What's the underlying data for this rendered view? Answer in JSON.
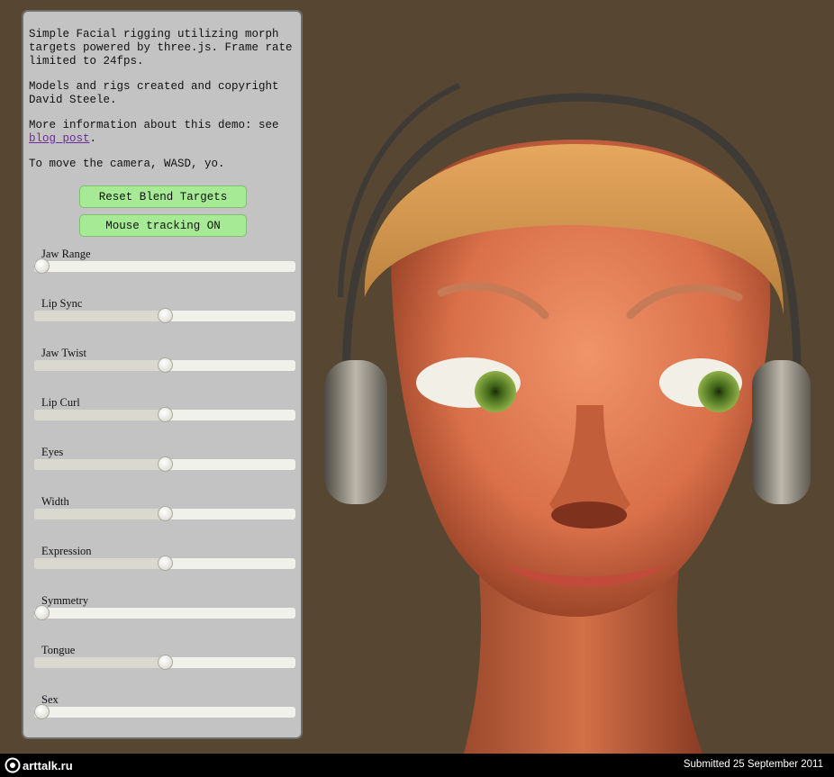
{
  "info": {
    "para1": "Simple Facial rigging utilizing morph targets powered by three.js. Frame rate limited to 24fps.",
    "para2": "Models and rigs created and copyright David Steele.",
    "para3_prefix": "More information about this demo: see ",
    "para3_link": "blog post",
    "para3_suffix": ".",
    "para4": "To move the camera, WASD, yo."
  },
  "buttons": {
    "reset": "Reset Blend Targets",
    "mouse": "Mouse tracking ON"
  },
  "sliders": [
    {
      "label": "Jaw Range",
      "value": 0
    },
    {
      "label": "Lip Sync",
      "value": 0.5
    },
    {
      "label": "Jaw Twist",
      "value": 0.5
    },
    {
      "label": "Lip Curl",
      "value": 0.5
    },
    {
      "label": "Eyes",
      "value": 0.5
    },
    {
      "label": "Width",
      "value": 0.5
    },
    {
      "label": "Expression",
      "value": 0.5
    },
    {
      "label": "Symmetry",
      "value": 0
    },
    {
      "label": "Tongue",
      "value": 0.5
    },
    {
      "label": "Sex",
      "value": 0
    }
  ],
  "footer": {
    "logo": "arttalk.ru",
    "submitted": "Submitted 25 September 2011"
  },
  "colors": {
    "background": "#564632",
    "panel": "#c3c3c3",
    "button": "#a6ea95",
    "link": "#6a2c95",
    "skin": "#d9704a",
    "iris": "#5f8a2a"
  }
}
